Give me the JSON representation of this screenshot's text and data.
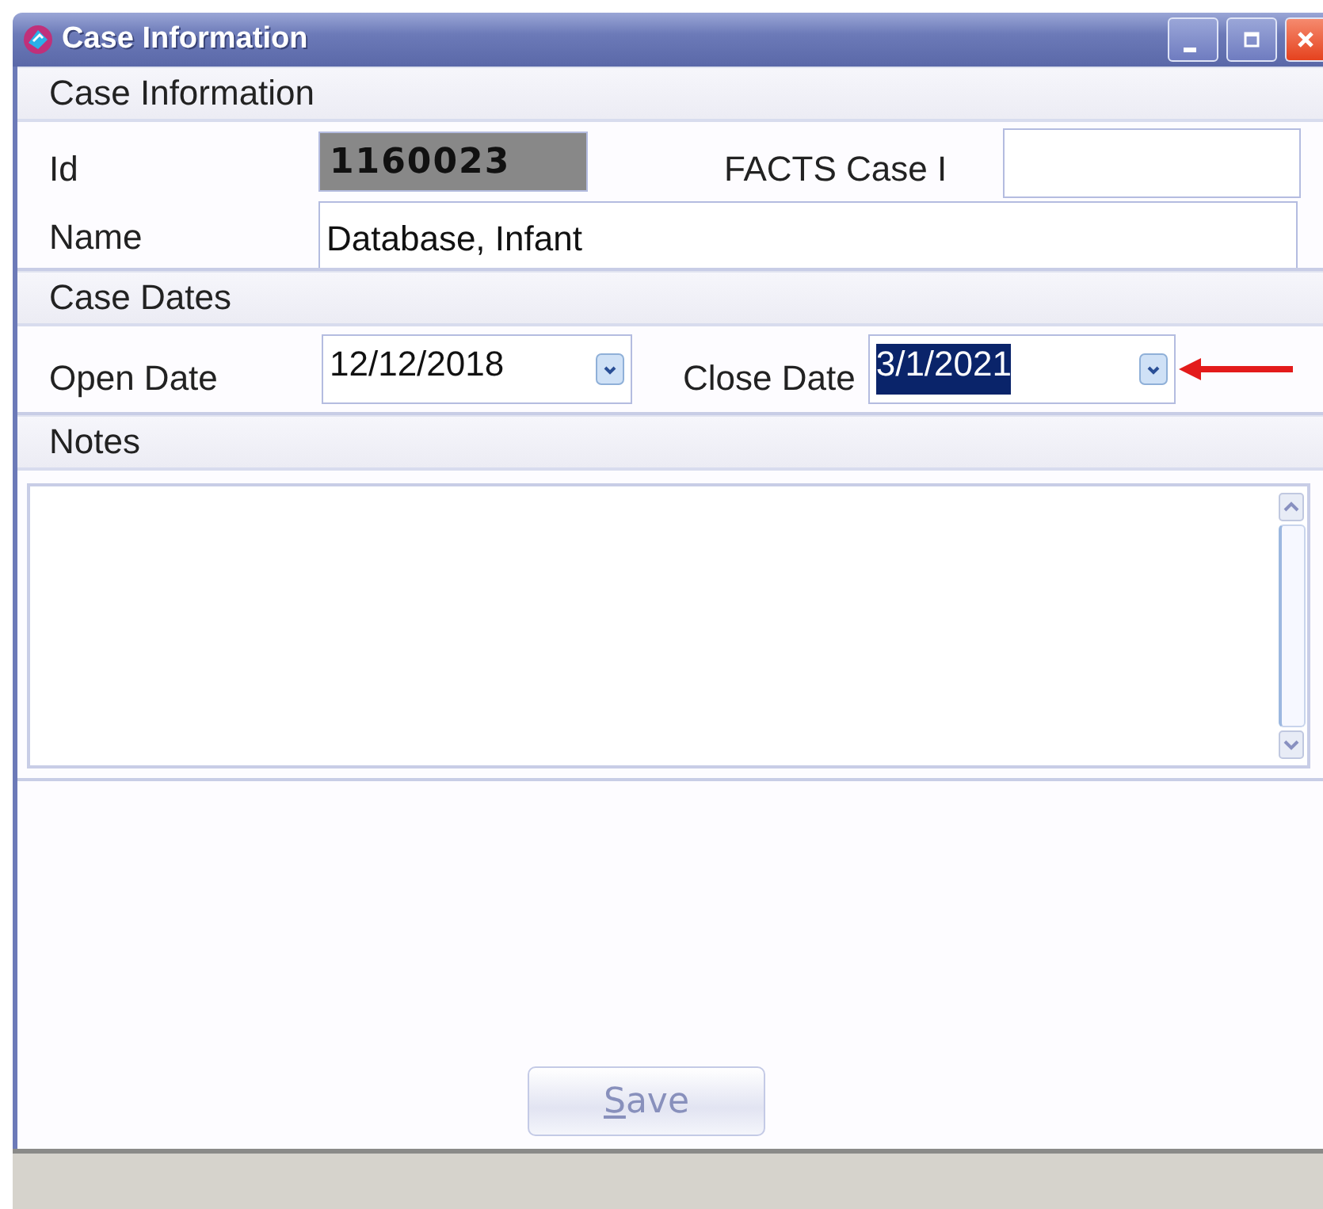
{
  "window": {
    "title": "Case Information"
  },
  "case_information": {
    "header": "Case Information",
    "id_label": "Id",
    "id_value": "1160023",
    "facts_label": "FACTS Case I",
    "name_label": "Name",
    "name_value": "Database, Infant"
  },
  "case_dates": {
    "header": "Case Dates",
    "open_label": "Open Date",
    "open_value": "12/12/2018",
    "close_label": "Close Date",
    "close_value": "3/1/2021",
    "close_selected": true
  },
  "notes": {
    "header": "Notes"
  },
  "save_button": {
    "label": "Save",
    "disabled": true
  }
}
